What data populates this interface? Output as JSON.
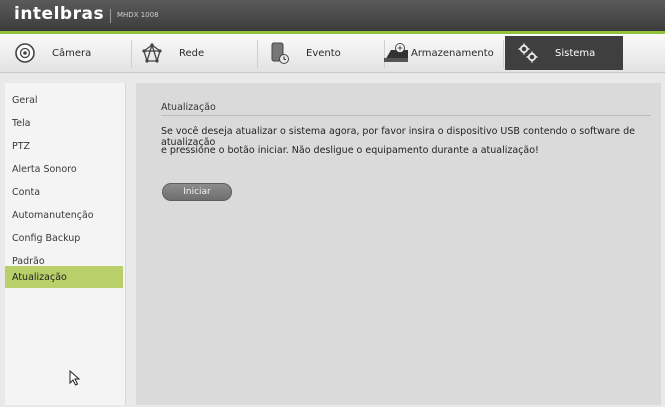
{
  "header": {
    "brand": "intelbras",
    "model": "MHDX 1008"
  },
  "tabs": [
    {
      "label": "Câmera",
      "icon": "camera-icon",
      "active": false
    },
    {
      "label": "Rede",
      "icon": "network-icon",
      "active": false
    },
    {
      "label": "Evento",
      "icon": "event-icon",
      "active": false
    },
    {
      "label": "Armazenamento",
      "icon": "storage-icon",
      "active": false
    },
    {
      "label": "Sistema",
      "icon": "gears-icon",
      "active": true
    }
  ],
  "sidebar": {
    "items": [
      {
        "label": "Geral"
      },
      {
        "label": "Tela"
      },
      {
        "label": "PTZ"
      },
      {
        "label": "Alerta Sonoro"
      },
      {
        "label": "Conta"
      },
      {
        "label": "Automanutenção"
      },
      {
        "label": "Config Backup"
      },
      {
        "label": "Padrão"
      },
      {
        "label": "Atualização",
        "active": true
      }
    ]
  },
  "main": {
    "section_title": "Atualização",
    "description_line1": "Se você deseja atualizar o sistema agora, por favor insira o dispositivo USB contendo o software de atualização",
    "description_line2": "e pressione o botão iniciar. Não desligue o equipamento durante a atualização!",
    "start_button": "Iniciar"
  },
  "colors": {
    "accent_green": "#92c23a",
    "active_sidebar": "#b8cf6a",
    "active_tab": "#3f3f3f"
  }
}
